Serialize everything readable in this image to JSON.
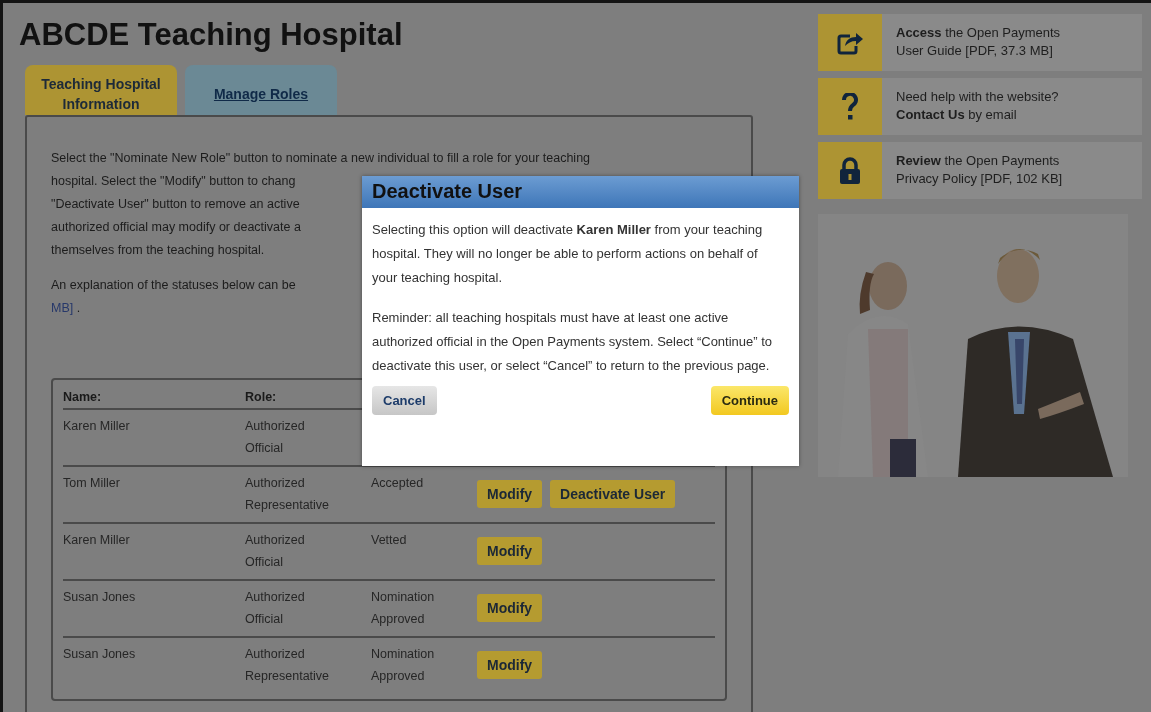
{
  "page_title": "ABCDE Teaching Hospital",
  "tabs": [
    {
      "label": "Teaching Hospital Information",
      "selected": false
    },
    {
      "label": "Manage Roles",
      "selected": true
    }
  ],
  "intro_lines": [
    "Select the \"Nominate New Role\" button to nominate a new individual to fill a role for your teaching",
    "hospital. Select the \"Modify\" button to chang",
    "\"Deactivate User\" button to remove an active",
    "authorized official may modify or deactivate a",
    "themselves from the teaching hospital."
  ],
  "explanation": {
    "text": "An explanation of the statuses below can be",
    "link": "MB]",
    "after": " ."
  },
  "table": {
    "columns": [
      "Name:",
      "Role:"
    ],
    "rows": [
      {
        "name": "Karen Miller",
        "role": [
          "Authorized",
          "Official"
        ]
      },
      {
        "name": "Tom Miller",
        "role": [
          "Authorized",
          "Representative"
        ],
        "status": [
          "Accepted"
        ],
        "actions": [
          "Modify",
          "Deactivate User"
        ]
      },
      {
        "name": "Karen Miller",
        "role": [
          "Authorized",
          "Official"
        ],
        "status": [
          "Vetted"
        ],
        "actions": [
          "Modify"
        ]
      },
      {
        "name": "Susan Jones",
        "role": [
          "Authorized",
          "Official"
        ],
        "status": [
          "Nomination",
          "Approved"
        ],
        "actions": [
          "Modify"
        ]
      },
      {
        "name": "Susan Jones",
        "role": [
          "Authorized",
          "Representative"
        ],
        "status": [
          "Nomination",
          "Approved"
        ],
        "actions": [
          "Modify"
        ]
      }
    ]
  },
  "help_links": [
    {
      "kind": "share",
      "lines": [
        "**Access** the Open Payments",
        "User Guide [PDF, 37.3 MB]"
      ]
    },
    {
      "kind": "help",
      "lines": [
        "Need help with the website?",
        "**Contact Us** by email"
      ]
    },
    {
      "kind": "lock",
      "lines": [
        "**Review** the Open Payments",
        "Privacy Policy [PDF, 102 KB]"
      ]
    }
  ],
  "dialog": {
    "title": "Deactivate User",
    "message": "Selecting this option will deactivate **Karen Miller** from your teaching hospital. They will no longer be able to perform actions on behalf of your teaching hospital.",
    "reminder": "Reminder: all teaching hospitals must have at least one active authorized official in the Open Payments system. Select “Continue” to deactivate this user, or select “Cancel” to return to the previous page.",
    "buttons": [
      {
        "label": "Cancel",
        "kind": "secondary"
      },
      {
        "label": "Continue",
        "kind": "primary"
      }
    ]
  }
}
